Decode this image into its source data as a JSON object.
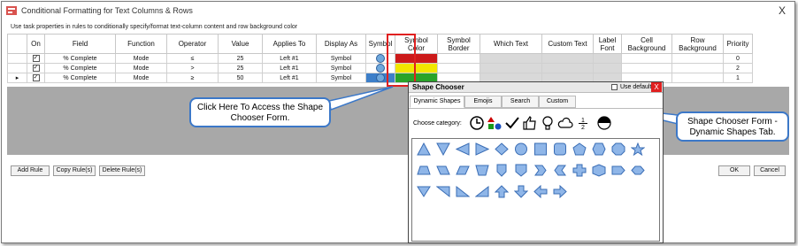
{
  "window": {
    "title": "Conditional Formatting for Text Columns & Rows",
    "close_glyph": "X",
    "instructions": "Use task properties in rules to conditionally specify/format text-column content and row background color"
  },
  "grid": {
    "headers": [
      "",
      "On",
      "Field",
      "Function",
      "Operator",
      "Value",
      "Applies To",
      "Display As",
      "Symbol",
      "Symbol Color",
      "Symbol Border",
      "Which Text",
      "Custom Text",
      "Label Font",
      "Cell Background",
      "Row Background",
      "Priority"
    ],
    "rows": [
      {
        "marker": "",
        "field": "% Complete",
        "function": "Mode",
        "operator": "≤",
        "value": "25",
        "applies_to": "Left #1",
        "display_as": "Symbol",
        "symbol_color": "red",
        "priority": "0"
      },
      {
        "marker": "",
        "field": "% Complete",
        "function": "Mode",
        "operator": ">",
        "value": "25",
        "applies_to": "Left #1",
        "display_as": "Symbol",
        "symbol_color": "yellow",
        "priority": "2"
      },
      {
        "marker": "▸",
        "field": "% Complete",
        "function": "Mode",
        "operator": "≥",
        "value": "50",
        "applies_to": "Left #1",
        "display_as": "Symbol",
        "symbol_color": "green",
        "priority": "1"
      }
    ]
  },
  "buttons": {
    "add_rule": "Add Rule",
    "copy_rules": "Copy Rule(s)",
    "delete_rules": "Delete Rule(s)",
    "ok": "OK",
    "cancel": "Cancel"
  },
  "callouts": {
    "symbol": "Click Here To Access the Shape Chooser Form.",
    "chooser": "Shape Chooser Form - Dynamic Shapes Tab."
  },
  "chooser": {
    "title": "Shape Chooser",
    "use_default_label": "Use default",
    "close_glyph": "X",
    "tabs": [
      "Dynamic Shapes",
      "Emojis",
      "Search",
      "Custom"
    ],
    "active_tab": "Dynamic Shapes",
    "category_label": "Choose category:",
    "category_icons": [
      "clock-icon",
      "shapes-icon",
      "checkmark-icon",
      "thumbs-up-icon",
      "lightbulb-icon",
      "cloud-icon",
      "fraction-icon",
      "half-circle-icon"
    ],
    "fraction_top": "1",
    "fraction_bottom": "2",
    "shape_rows": [
      [
        "triangle-up",
        "triangle-down",
        "triangle-left",
        "triangle-right",
        "diamond",
        "circle",
        "square",
        "rounded-square",
        "pentagon",
        "hexagon",
        "octagon",
        "star"
      ],
      [
        "trapezoid",
        "parallelogram-right",
        "parallelogram-left",
        "trapezoid-inverted",
        "shield",
        "pentagon-down",
        "chevron-right",
        "chevron-left",
        "cross",
        "hexagon-flat",
        "arrow-banner",
        "double-chevron"
      ],
      [
        "corner-triangle-tl",
        "corner-triangle-tr",
        "corner-triangle-bl",
        "corner-triangle-br",
        "arrow-up",
        "arrow-down",
        "arrow-left",
        "arrow-right"
      ]
    ]
  },
  "colors": {
    "shape_fill": "#8fb6e8",
    "shape_stroke": "#3a6db5",
    "callout_border": "#3c78c8",
    "highlight": "#e02020"
  }
}
